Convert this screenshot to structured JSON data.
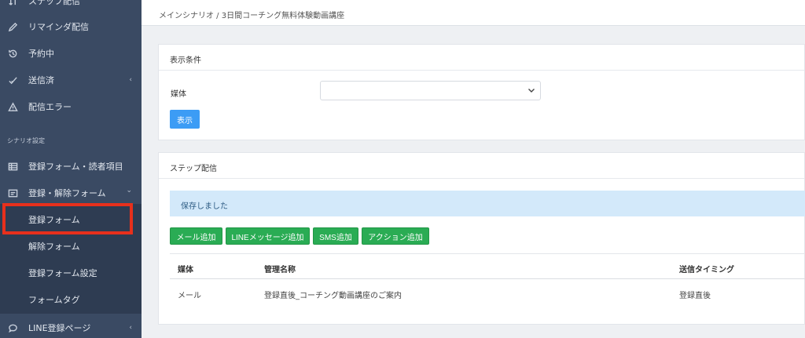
{
  "sidebar": {
    "items_top": [
      {
        "label": "ステップ配信",
        "icon": "step-icon",
        "has_caret": false
      },
      {
        "label": "リマインダ配信",
        "icon": "pencil-icon",
        "has_caret": false
      },
      {
        "label": "予約中",
        "icon": "history-icon",
        "has_caret": false
      },
      {
        "label": "送信済",
        "icon": "check-icon",
        "has_caret": true
      },
      {
        "label": "配信エラー",
        "icon": "warning-icon",
        "has_caret": false
      }
    ],
    "section_label": "シナリオ設定",
    "items_mid": [
      {
        "label": "登録フォーム・読者項目",
        "icon": "table-icon",
        "has_caret": false
      },
      {
        "label": "登録・解除フォーム",
        "icon": "form-icon",
        "has_caret": true
      }
    ],
    "sub_items": [
      {
        "label": "登録フォーム"
      },
      {
        "label": "解除フォーム"
      },
      {
        "label": "登録フォーム設定"
      },
      {
        "label": "フォームタグ"
      }
    ],
    "items_bottom": [
      {
        "label": "LINE登録ページ",
        "icon": "chat-icon",
        "has_caret": true
      }
    ],
    "caret_left": "‹",
    "caret_down": "⌄",
    "accent_color": "#e8301c"
  },
  "breadcrumb": {
    "text": "メインシナリオ / 3日間コーチング無料体験動画講座"
  },
  "filter_card": {
    "title": "表示条件",
    "media_label": "媒体",
    "media_value": "",
    "show_button": "表示"
  },
  "step_card": {
    "title": "ステップ配信",
    "alert": "保存しました",
    "buttons": [
      "メール追加",
      "LINEメッセージ追加",
      "SMS追加",
      "アクション追加"
    ],
    "columns": [
      "媒体",
      "管理名称",
      "送信タイミング"
    ],
    "rows": [
      [
        "メール",
        "登録直後_コーチング動画講座のご案内",
        "登録直後"
      ]
    ]
  },
  "colors": {
    "sidebar_bg": "#3a4a63",
    "button_blue": "#3c9cf5",
    "button_green": "#2aac54",
    "alert_bg": "#d3e9fa"
  }
}
